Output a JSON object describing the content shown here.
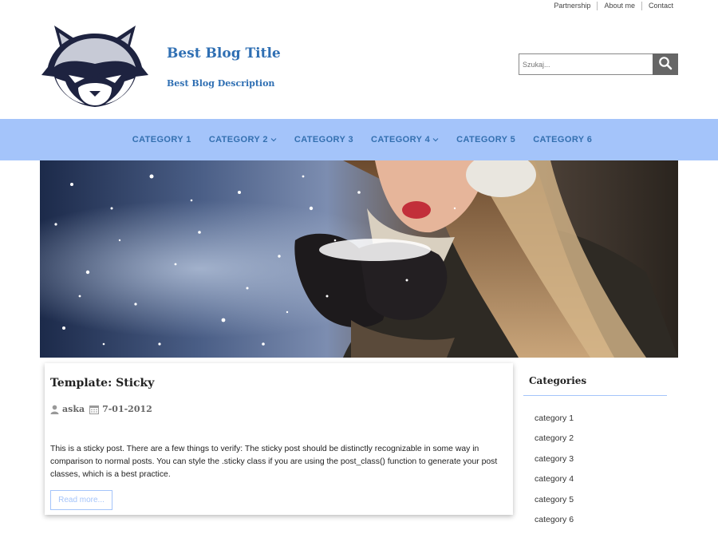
{
  "top_links": [
    "Partnership",
    "About me",
    "Contact"
  ],
  "site": {
    "title": "Best Blog Title",
    "description": "Best Blog Description",
    "logo_icon": "raccoon-logo-icon"
  },
  "search": {
    "placeholder": "Szukaj...",
    "icon": "search-icon"
  },
  "categories": [
    {
      "label": "CATEGORY 1",
      "has_dropdown": false
    },
    {
      "label": "CATEGORY 2",
      "has_dropdown": true
    },
    {
      "label": "CATEGORY 3",
      "has_dropdown": false
    },
    {
      "label": "CATEGORY 4",
      "has_dropdown": true
    },
    {
      "label": "CATEGORY 5",
      "has_dropdown": false
    },
    {
      "label": "CATEGORY 6",
      "has_dropdown": false
    }
  ],
  "post": {
    "title": "Template: Sticky",
    "author": "aska",
    "date": "7-01-2012",
    "excerpt": "This is a sticky post. There are a few things to verify: The sticky post should be distinctly recognizable in some way in comparison to normal posts. You can style the .sticky class if you are using the post_class() function to generate your post classes, which is a best practice.",
    "read_more": "Read more..."
  },
  "sidebar": {
    "heading": "Categories",
    "items": [
      "category 1",
      "category 2",
      "category 3",
      "category 4",
      "category 5",
      "category 6"
    ]
  },
  "colors": {
    "accent": "#2f6fb3",
    "menu_bar": "#a4c4fa",
    "search_button": "#666666"
  }
}
